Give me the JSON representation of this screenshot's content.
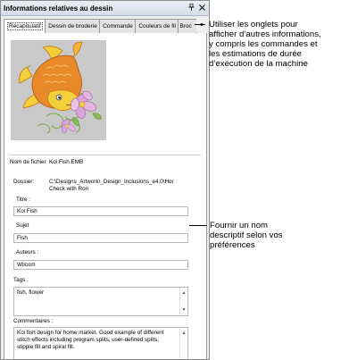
{
  "panel": {
    "title": "Informations relatives au dessin",
    "pin_icon": "pin-icon",
    "close_icon": "close-icon"
  },
  "tabs": [
    {
      "label": "Récapitulatif",
      "active": true
    },
    {
      "label": "Dessin de broderie",
      "active": false
    },
    {
      "label": "Commande",
      "active": false
    },
    {
      "label": "Couleurs de fil",
      "active": false
    },
    {
      "label": "Broc",
      "active": false
    }
  ],
  "tab_scroll_icon": "scroll-arrows-icon",
  "summary": {
    "filename_label": "Nom de fichier",
    "filename_value": "Koi Fish.EMB",
    "folder_label": "Dossier:",
    "folder_value_1": "C:\\Designs_Artwork\\_Design_Inclusions_e4.0\\Hor",
    "folder_value_2": "Check with Ron",
    "title_label": "Titre :",
    "title_value": "Koi Fish",
    "subject_label": "Sujet",
    "subject_value": "Fish",
    "authors_label": "Auteurs :",
    "authors_value": "Wilcom",
    "tags_label": "Tags :",
    "tags_value": "fish, flower",
    "comments_label": "Commentaires :",
    "comments_line_1": "Koi fish design for home market. Good example of different",
    "comments_line_2": "stitch effects including program splits, user-defined splits,",
    "comments_line_3": "stipple fill and spiral fill."
  },
  "annotations": {
    "tabs_note_1": "Utiliser les onglets pour",
    "tabs_note_2": "afficher d’autres informations,",
    "tabs_note_3": "y compris les commandes et",
    "tabs_note_4": "les estimations de durée",
    "tabs_note_5": "d’exécution de la machine",
    "name_note_1": "Fournir un nom",
    "name_note_2": "descriptif selon vos",
    "name_note_3": "préférences"
  },
  "colors": {
    "preview_bg": "#c9c9c9",
    "fish_orange": "#e8892a",
    "fish_yellow": "#f3cf3c",
    "flower_pink": "#d9a5d8",
    "leaf_green": "#7fa84a"
  }
}
